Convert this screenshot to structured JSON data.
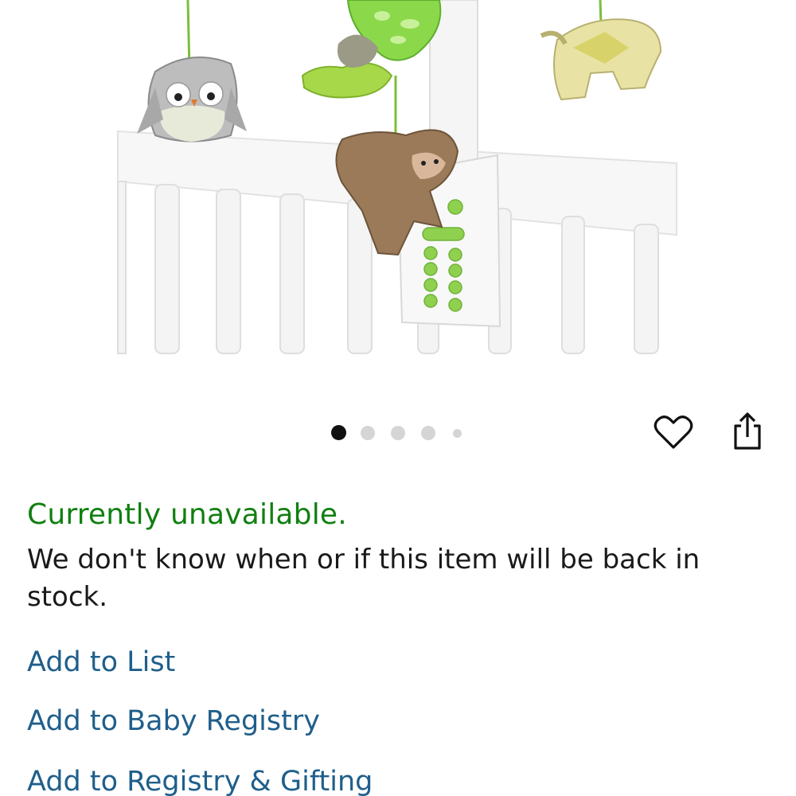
{
  "product": {
    "image_alt": "Crib mobile with owl, turtle, monkey and elephant plush toys",
    "image_count": 5,
    "current_image": 1
  },
  "actions": {
    "wishlist_icon": "heart-outline-icon",
    "share_icon": "share-icon"
  },
  "availability": {
    "status": "Currently unavailable.",
    "message": "We don't know when or if this item will be back in stock.",
    "status_color": "#107f10"
  },
  "links": {
    "add_to_list": "Add to List",
    "add_to_baby_registry": "Add to Baby Registry",
    "add_to_registry_gifting": "Add to Registry & Gifting",
    "link_color": "#1f5f8b"
  }
}
